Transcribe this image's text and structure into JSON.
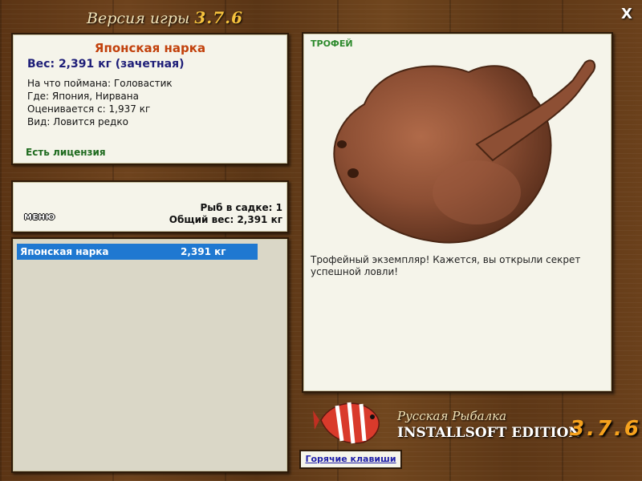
{
  "window": {
    "title_prefix": "Версия игры",
    "title_version": "3.7.6",
    "close_label": "X"
  },
  "fish_info": {
    "name": "Японская нарка",
    "weight": "Вес: 2,391 кг (зачетная)",
    "bait": "На что поймана: Головастик",
    "location": "Где: Япония, Нирвана",
    "min_weight": "Оценивается с: 1,937 кг",
    "rarity": "Вид: Ловится редко",
    "license": "Есть лицензия"
  },
  "cage": {
    "count": "Рыб в садке: 1",
    "total_weight": "Общий вес: 2,391 кг"
  },
  "menu": {
    "label": "МЕНЮ"
  },
  "catch_list": [
    {
      "name": "Японская нарка",
      "weight": "2,391 кг",
      "selected": true
    }
  ],
  "detail": {
    "badge": "ТРОФЕЙ",
    "description": "Трофейный экземпляр! Кажется, вы открыли секрет успешной ловли!"
  },
  "logo": {
    "line1": "Русская Рыбалка",
    "line2": "INSTALLSOFT EDITION",
    "version": "3.7.6"
  },
  "hotkeys": {
    "label": "Горячие клавиши"
  },
  "colors": {
    "fish_name": "#c2410c",
    "weight": "#1e1e78",
    "license": "#1f6b1f",
    "selection": "#1f78d1",
    "trophy": "#2d8a2d"
  }
}
